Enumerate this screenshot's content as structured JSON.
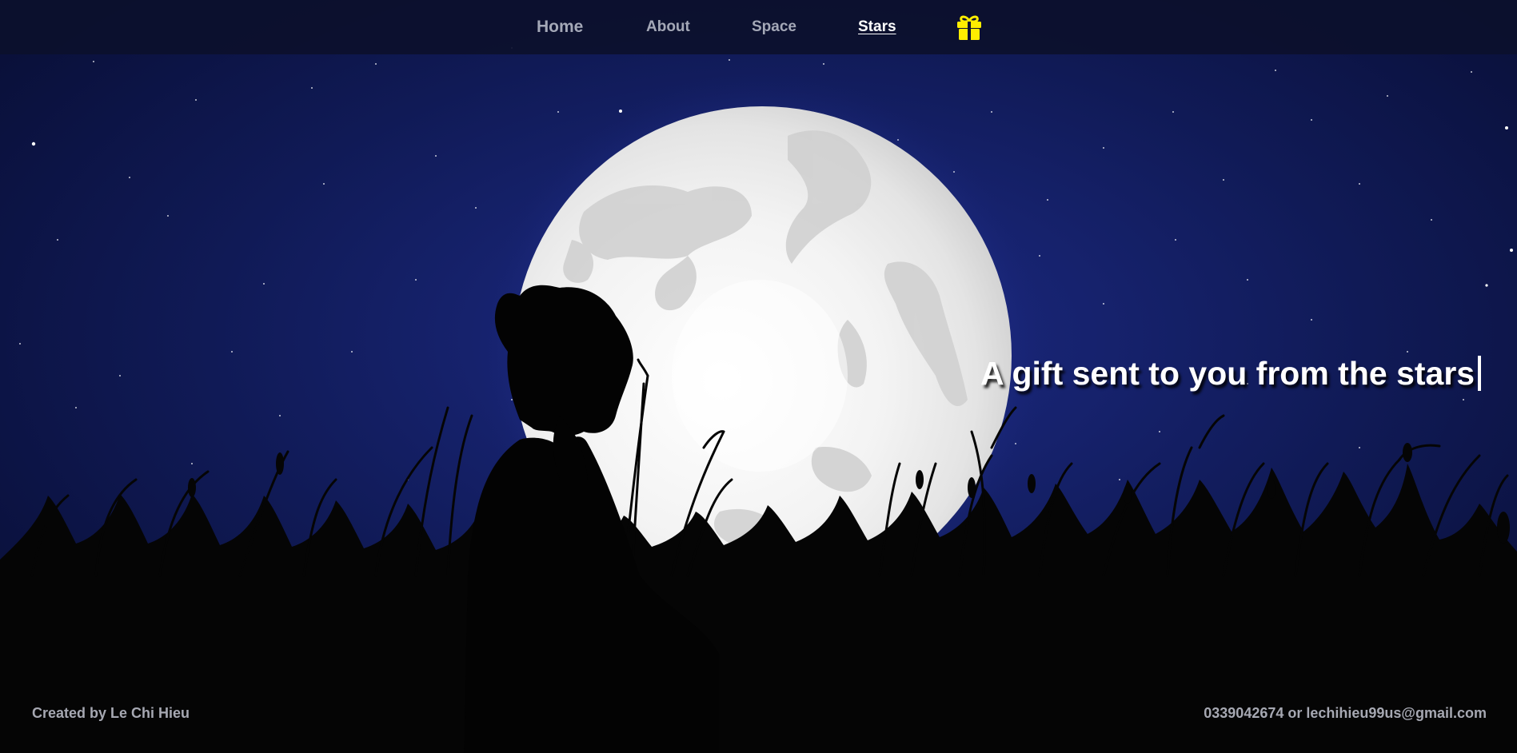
{
  "nav": {
    "items": [
      {
        "label": "Home"
      },
      {
        "label": "About"
      },
      {
        "label": "Space"
      },
      {
        "label": "Stars",
        "active": true
      }
    ],
    "gift_icon": "gift-icon",
    "gift_color": "#ffee00"
  },
  "hero": {
    "headline": "A gift sent to you from the stars"
  },
  "footer": {
    "credit": "Created by Le Chi Hieu",
    "contact": "0339042674 or lechihieu99us@gmail.com"
  },
  "colors": {
    "sky": "#16226d",
    "moon": "#f4f4f4",
    "silhouette": "#050505",
    "nav_text": "#a4a8b7"
  }
}
